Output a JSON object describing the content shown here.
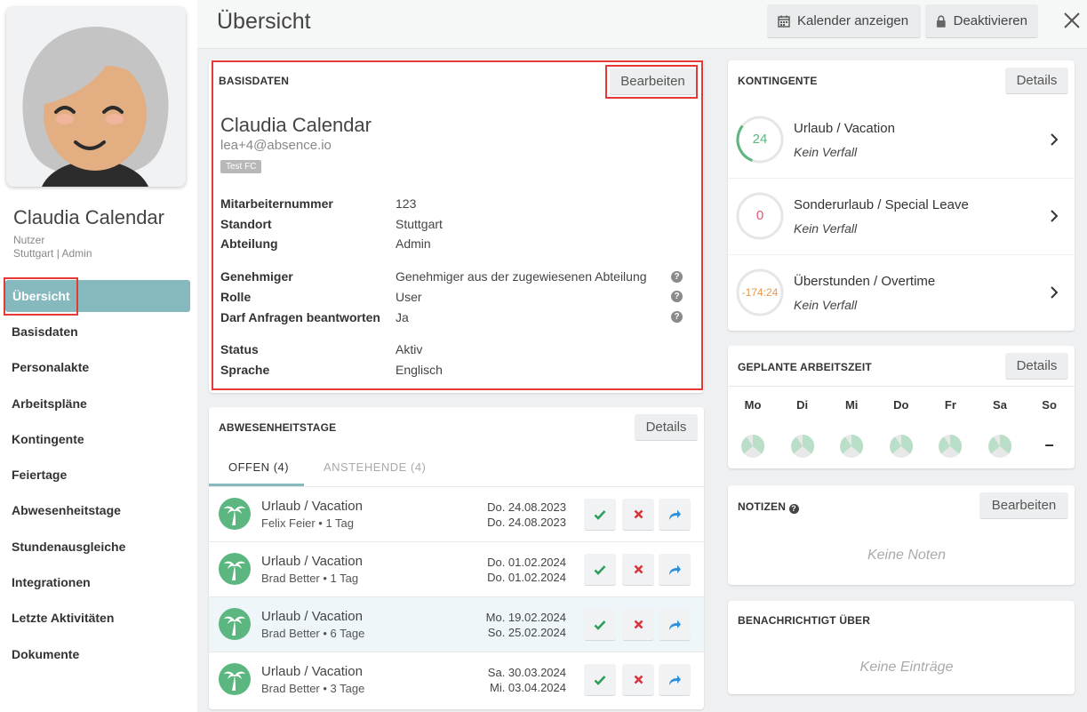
{
  "profile": {
    "name": "Claudia Calendar",
    "role": "Nutzer",
    "location": "Stuttgart | Admin"
  },
  "nav": {
    "items": [
      {
        "label": "Übersicht"
      },
      {
        "label": "Basisdaten"
      },
      {
        "label": "Personalakte"
      },
      {
        "label": "Arbeitspläne"
      },
      {
        "label": "Kontingente"
      },
      {
        "label": "Feiertage"
      },
      {
        "label": "Abwesenheitstage"
      },
      {
        "label": "Stundenausgleiche"
      },
      {
        "label": "Integrationen"
      },
      {
        "label": "Letzte Aktivitäten"
      },
      {
        "label": "Dokumente"
      }
    ]
  },
  "header": {
    "title": "Übersicht",
    "calendar_label": "Kalender anzeigen",
    "deactivate_label": "Deaktivieren"
  },
  "basis": {
    "title": "BASISDATEN",
    "edit_label": "Bearbeiten",
    "name": "Claudia Calendar",
    "email": "lea+4@absence.io",
    "tag": "Test FC",
    "fields": [
      {
        "label": "Mitarbeiternummer",
        "value": "123"
      },
      {
        "label": "Standort",
        "value": "Stuttgart"
      },
      {
        "label": "Abteilung",
        "value": "Admin"
      },
      {
        "label": "Genehmiger",
        "value": "Genehmiger aus der zugewiesenen Abteilung"
      },
      {
        "label": "Rolle",
        "value": "User"
      },
      {
        "label": "Darf Anfragen beantworten",
        "value": "Ja"
      },
      {
        "label": "Status",
        "value": "Aktiv"
      },
      {
        "label": "Sprache",
        "value": "Englisch"
      }
    ]
  },
  "absences": {
    "title": "ABWESENHEITSTAGE",
    "details_label": "Details",
    "tab_open": "OFFEN",
    "tab_open_count": "(4)",
    "tab_pending": "ANSTEHENDE",
    "tab_pending_count": "(4)",
    "rows": [
      {
        "type": "Urlaub / Vacation",
        "who": "Felix Feier • 1 Tag",
        "from": "Do. 24.08.2023",
        "to": "Do. 24.08.2023"
      },
      {
        "type": "Urlaub / Vacation",
        "who": "Brad Better • 1 Tag",
        "from": "Do. 01.02.2024",
        "to": "Do. 01.02.2024"
      },
      {
        "type": "Urlaub / Vacation",
        "who": "Brad Better • 6 Tage",
        "from": "Mo. 19.02.2024",
        "to": "So. 25.02.2024"
      },
      {
        "type": "Urlaub / Vacation",
        "who": "Brad Better • 3 Tage",
        "from": "Sa. 30.03.2024",
        "to": "Mi. 03.04.2024"
      }
    ]
  },
  "quotas": {
    "title": "KONTINGENTE",
    "details_label": "Details",
    "items": [
      {
        "name": "Urlaub / Vacation",
        "sub": "Kein Verfall",
        "value": "24",
        "color": "#5bb67f",
        "fill": 0.3
      },
      {
        "name": "Sonderurlaub / Special Leave",
        "sub": "Kein Verfall",
        "value": "0",
        "color": "#e8556f",
        "fill": 0
      },
      {
        "name": "Überstunden / Overtime",
        "sub": "Kein Verfall",
        "value": "-174:24",
        "color": "#e8954a",
        "fill": 0
      }
    ]
  },
  "schedule": {
    "title": "GEPLANTE ARBEITSZEIT",
    "details_label": "Details",
    "days": [
      "Mo",
      "Di",
      "Mi",
      "Do",
      "Fr",
      "Sa",
      "So"
    ],
    "no_work_mark": "–",
    "fill_color": "#b9dfc8"
  },
  "notes": {
    "title": "NOTIZEN",
    "edit_label": "Bearbeiten",
    "empty": "Keine Noten"
  },
  "notified": {
    "title": "BENACHRICHTIGT ÜBER",
    "empty": "Keine Einträge"
  },
  "help_glyph": "?"
}
